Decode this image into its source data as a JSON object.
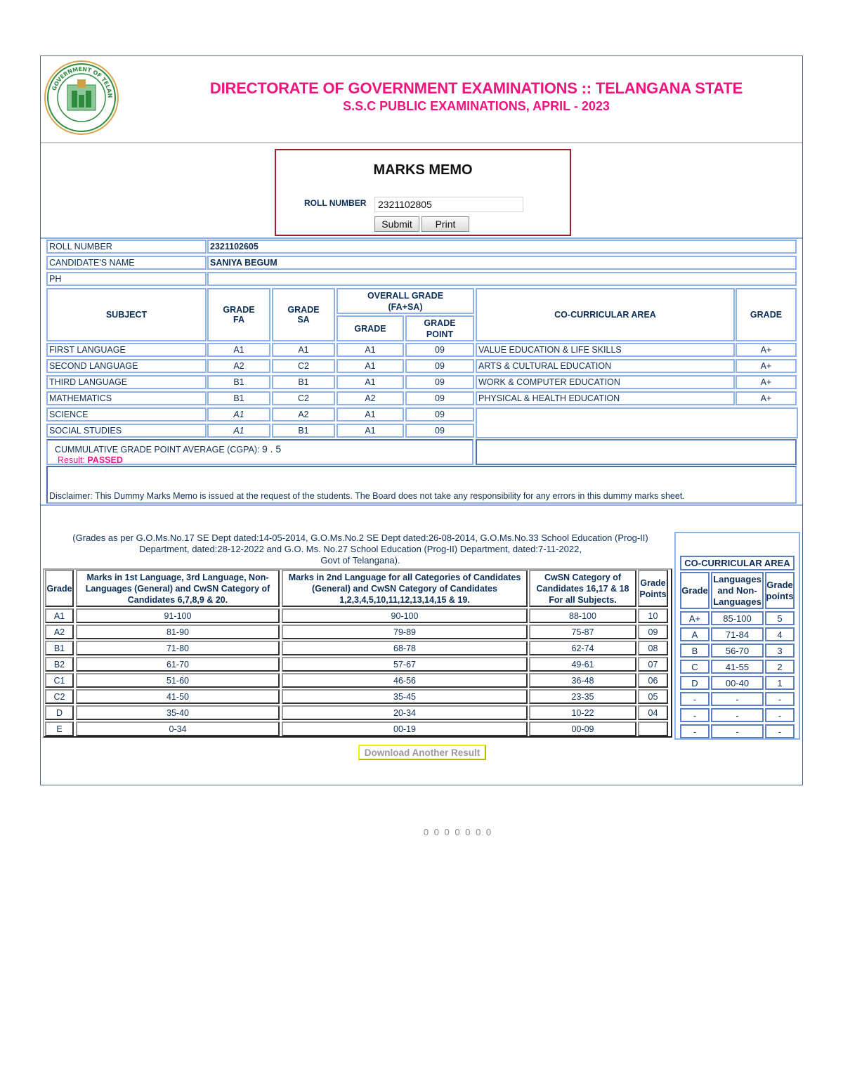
{
  "header": {
    "logo_icon": "telangana-government-emblem",
    "title": "DIRECTORATE OF GOVERNMENT EXAMINATIONS :: TELANGANA STATE",
    "subtitle": "S.S.C PUBLIC EXAMINATIONS, APRIL - 2023",
    "accent_color": "#f0147f"
  },
  "memo_form": {
    "title": "MARKS MEMO",
    "roll_label": "ROLL NUMBER",
    "roll_value": "2321102805",
    "submit_label": "Submit",
    "print_label": "Print"
  },
  "candidate": {
    "roll_label": "ROLL NUMBER",
    "roll_value": "2321102605",
    "name_label": "CANDIDATE'S NAME",
    "name_value": "SANIYA BEGUM",
    "ph_label": "PH",
    "ph_value": ""
  },
  "marks_table": {
    "headers": {
      "subject": "SUBJECT",
      "grade_fa": "GRADE FA",
      "grade_sa": "GRADE SA",
      "overall": "OVERALL GRADE (FA+SA)",
      "overall_grade": "GRADE",
      "overall_point": "GRADE POINT",
      "co_area": "CO-CURRICULAR AREA",
      "co_grade": "GRADE"
    },
    "rows": [
      {
        "subject": "FIRST LANGUAGE",
        "fa": "A1",
        "sa": "A1",
        "grade": "A1",
        "point": "09"
      },
      {
        "subject": "SECOND LANGUAGE",
        "fa": "A2",
        "sa": "C2",
        "grade": "A1",
        "point": "09"
      },
      {
        "subject": "THIRD LANGUAGE",
        "fa": "B1",
        "sa": "B1",
        "grade": "A1",
        "point": "09"
      },
      {
        "subject": "MATHEMATICS",
        "fa": "B1",
        "sa": "C2",
        "grade": "A2",
        "point": "09"
      },
      {
        "subject": "SCIENCE",
        "fa": "A1",
        "sa": "A2",
        "grade": "A1",
        "point": "09"
      },
      {
        "subject": "SOCIAL STUDIES",
        "fa": "A1",
        "sa": "B1",
        "grade": "A1",
        "point": "09"
      }
    ],
    "co_rows": [
      {
        "area": "VALUE EDUCATION & LIFE SKILLS",
        "grade": "A+"
      },
      {
        "area": "ARTS & CULTURAL EDUCATION",
        "grade": "A+"
      },
      {
        "area": "WORK & COMPUTER EDUCATION",
        "grade": "A+"
      },
      {
        "area": "PHYSICAL & HEALTH EDUCATION",
        "grade": "A+"
      }
    ],
    "cgpa_label": "CUMMULATIVE GRADE POINT AVERAGE (CGPA):",
    "cgpa_value": "9 . 5",
    "result_label": "Result:",
    "result_value": "PASSED"
  },
  "disclaimer": "Disclaimer: This Dummy Marks Memo is issued at the request of the students. The Board does not take any responsibility for any errors in this dummy marks sheet.",
  "grades_note": {
    "line1": "(Grades as per G.O.Ms.No.17 SE Dept dated:14-05-2014, G.O.Ms.No.2 SE Dept dated:26-08-2014, G.O.Ms.No.33 School Education (Prog-II)",
    "line2": "Department, dated:28-12-2022 and G.O. Ms. No.27 School Education (Prog-II) Department, dated:7-11-2022,",
    "line3": "Govt of Telangana)."
  },
  "grade_table": {
    "headers": [
      "Grade",
      "Marks in 1st Language, 3rd Language, Non-Languages (General) and CwSN Category of Candidates 6,7,8,9 & 20.",
      "Marks in 2nd Language for all Categories of Candidates (General) and CwSN Category of Candidates 1,2,3,4,5,10,11,12,13,14,15 & 19.",
      "CwSN Category of Candidates 16,17 & 18 For all Subjects.",
      "Grade Points"
    ],
    "rows": [
      [
        "A1",
        "91-100",
        "90-100",
        "88-100",
        "10"
      ],
      [
        "A2",
        "81-90",
        "79-89",
        "75-87",
        "09"
      ],
      [
        "B1",
        "71-80",
        "68-78",
        "62-74",
        "08"
      ],
      [
        "B2",
        "61-70",
        "57-67",
        "49-61",
        "07"
      ],
      [
        "C1",
        "51-60",
        "46-56",
        "36-48",
        "06"
      ],
      [
        "C2",
        "41-50",
        "35-45",
        "23-35",
        "05"
      ],
      [
        "D",
        "35-40",
        "20-34",
        "10-22",
        "04"
      ],
      [
        "E",
        "0-34",
        "00-19",
        "00-09",
        ""
      ]
    ]
  },
  "co_grade_table": {
    "title": "CO-CURRICULAR AREA",
    "headers": [
      "Grade",
      "Languages and Non-Languages",
      "Grade points"
    ],
    "rows": [
      [
        "A+",
        "85-100",
        "5"
      ],
      [
        "A",
        "71-84",
        "4"
      ],
      [
        "B",
        "56-70",
        "3"
      ],
      [
        "C",
        "41-55",
        "2"
      ],
      [
        "D",
        "00-40",
        "1"
      ],
      [
        "-",
        "-",
        "-"
      ],
      [
        "-",
        "-",
        "-"
      ],
      [
        "-",
        "-",
        "-"
      ]
    ]
  },
  "download_label": "Download Another Result",
  "counter": "0 0 0 0 0 0 0"
}
